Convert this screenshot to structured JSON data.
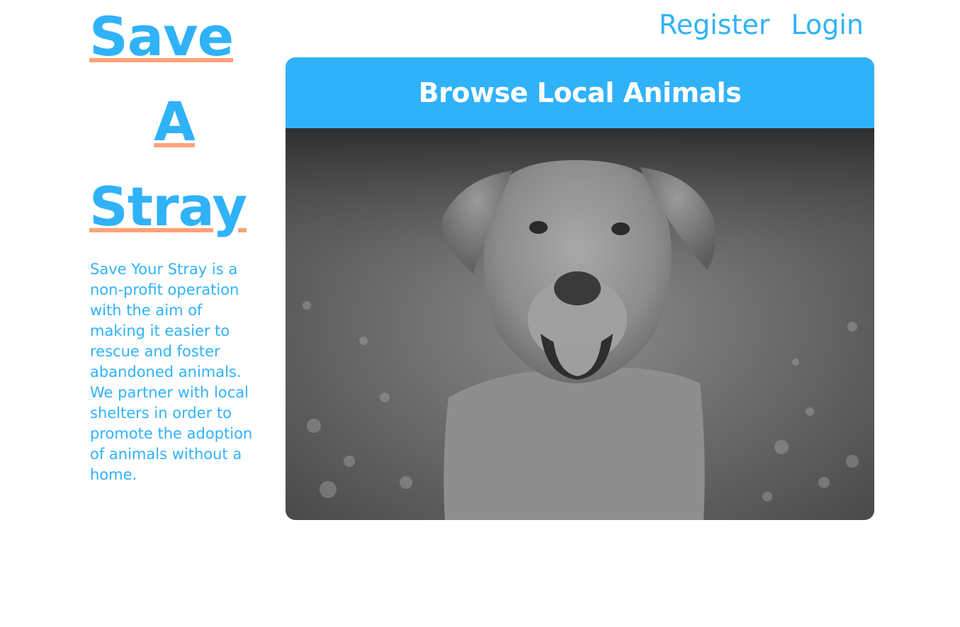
{
  "brand": {
    "line1": "Save",
    "line2": "A",
    "line3": "Stray"
  },
  "about": {
    "text": "Save Your Stray is a non-profit operation with the aim of making it easier to rescue and foster abandoned animals. We partner with local shelters in order to promote the adoption of animals without a home."
  },
  "nav": {
    "register": "Register",
    "login": "Login"
  },
  "card": {
    "title": "Browse Local Animals"
  },
  "colors": {
    "accent": "#30b2f9",
    "underline": "#ffa27a"
  }
}
